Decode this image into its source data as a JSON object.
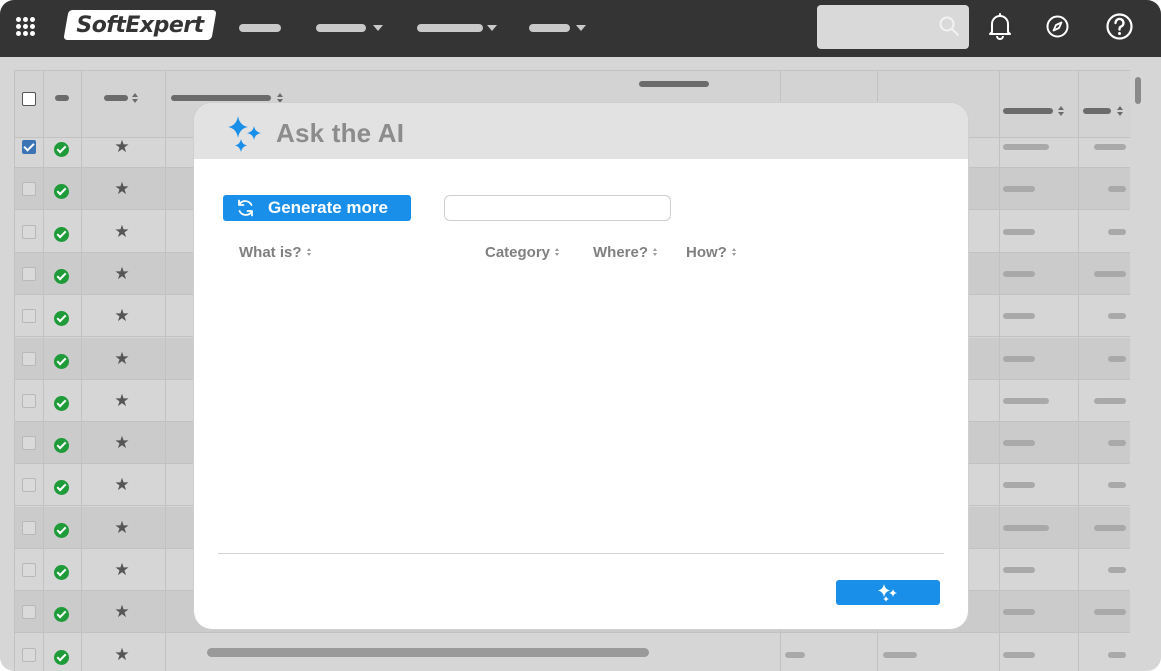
{
  "app": {
    "logo_text": "SoftExpert"
  },
  "topbar": {
    "apps_icon": "apps-grid-icon",
    "search": {
      "value": "",
      "placeholder": "",
      "icon": "search-icon"
    },
    "icons": [
      "bell-icon",
      "compass-icon",
      "help-icon"
    ]
  },
  "table": {
    "row_count": 13,
    "checked_rows": [
      0
    ],
    "row_icons": [
      "checkbox",
      "status-ok-icon",
      "star-icon"
    ]
  },
  "modal": {
    "title": "Ask the AI",
    "title_icon": "sparkle-icon",
    "generate_button": {
      "label": "Generate more",
      "icon": "refresh-icon"
    },
    "filter_input": {
      "value": "",
      "placeholder": ""
    },
    "columns": [
      "What is?",
      "Category",
      "Where?",
      "How?"
    ],
    "ask_button": {
      "icon": "sparkle-icon"
    }
  },
  "colors": {
    "accent": "#1a8fe9",
    "topbar": "#343434",
    "status_ok": "#1f9b3a",
    "checkbox_checked": "#3a74b5"
  }
}
